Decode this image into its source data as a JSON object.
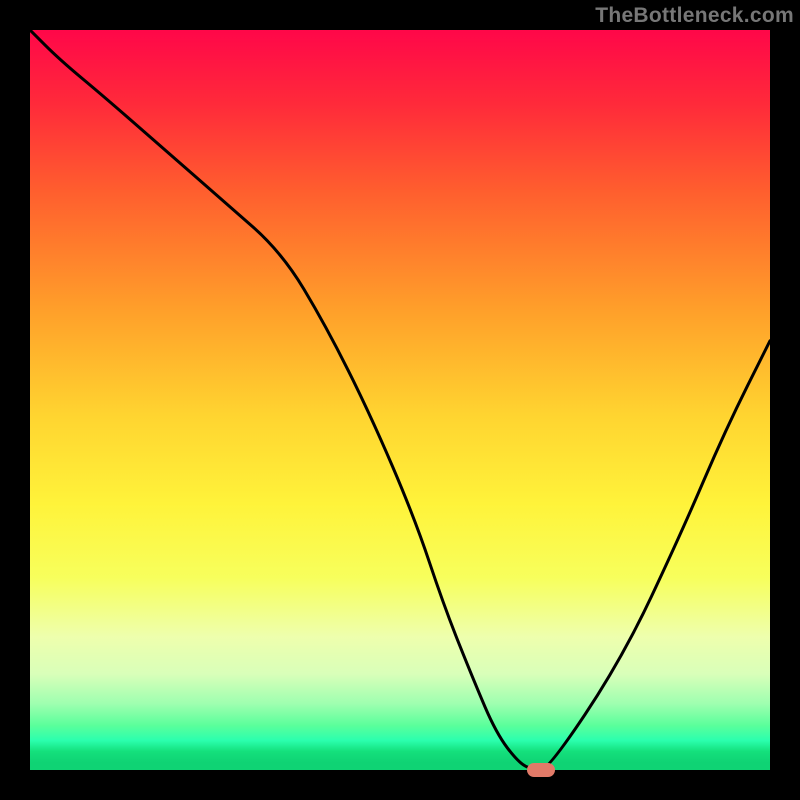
{
  "watermark": "TheBottleneck.com",
  "colors": {
    "page_bg": "#000000",
    "gradient_top": "#ff0749",
    "gradient_bottom": "#0fd374",
    "curve_stroke": "#000000",
    "marker_fill": "#e17a68",
    "watermark_text": "#777777"
  },
  "chart_data": {
    "type": "line",
    "title": "",
    "xlabel": "",
    "ylabel": "",
    "xlim": [
      0,
      100
    ],
    "ylim": [
      0,
      100
    ],
    "grid": false,
    "legend": false,
    "x": [
      0,
      4,
      10,
      18,
      26,
      34,
      40,
      46,
      52,
      56,
      60,
      63,
      66,
      68,
      70,
      80,
      88,
      94,
      100
    ],
    "values": [
      100,
      96,
      91,
      84,
      77,
      70,
      60,
      48,
      34,
      22,
      12,
      5,
      1,
      0,
      0,
      15,
      32,
      46,
      58
    ],
    "marker": {
      "x": 69,
      "y": 0
    },
    "note": "Values estimated from a 740x740 plot area inside an 800x800 image with a vertical red→green gradient background; the black curve descends steeply from top-left, bottoms out near x≈69, then rises toward the right. No axes, ticks, labels, or legend are visible."
  }
}
